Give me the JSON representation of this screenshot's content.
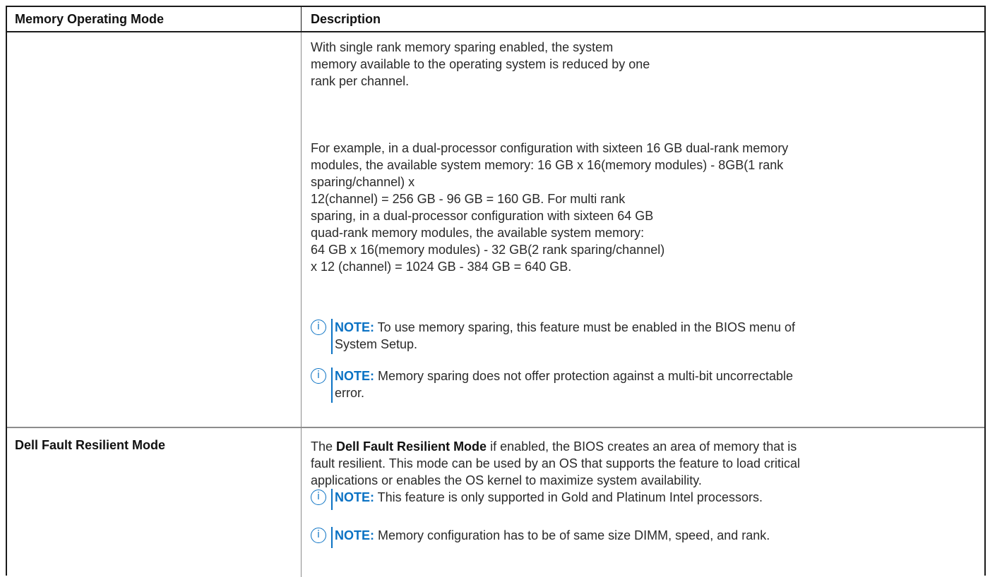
{
  "table": {
    "headers": [
      "Memory Operating Mode",
      "Description"
    ],
    "rows": [
      {
        "mode": "",
        "paragraphs": [
          [
            "With single rank memory sparing enabled, the system",
            "memory available to the operating system is reduced by one",
            "rank per channel."
          ],
          [
            "For example, in a dual-processor configuration with sixteen 16 GB dual-rank memory",
            "modules, the available system memory: 16 GB x 16(memory modules) - 8GB(1 rank",
            "sparing/channel) x",
            "12(channel) = 256 GB - 96 GB = 160 GB. For multi rank",
            "sparing, in a dual-processor configuration with sixteen 64 GB",
            "quad-rank memory modules, the available system memory:",
            "64 GB x 16(memory modules) - 32 GB(2 rank sparing/channel)",
            "x 12 (channel) = 1024 GB - 384 GB = 640 GB."
          ]
        ],
        "notes": [
          {
            "label": "NOTE:",
            "lines": [
              " To use memory sparing, this feature must be enabled in the BIOS menu of",
              "System Setup."
            ]
          },
          {
            "label": "NOTE:",
            "lines": [
              " Memory sparing does not offer protection against a multi-bit uncorrectable",
              "error."
            ]
          }
        ]
      },
      {
        "mode": "Dell Fault Resilient Mode",
        "intro_prefix": "The ",
        "intro_bold": "Dell Fault Resilient Mode",
        "intro_rest": " if enabled, the BIOS creates an area of memory that is",
        "intro_lines": [
          "fault resilient. This mode can be used by an OS that supports the feature to load critical",
          "applications or enables the OS kernel to maximize system availability."
        ],
        "notes": [
          {
            "label": "NOTE:",
            "lines": [
              " This feature is only supported in Gold and Platinum Intel processors."
            ]
          },
          {
            "label": "NOTE:",
            "lines": [
              " Memory configuration has to be of same size DIMM, speed, and rank."
            ]
          }
        ]
      }
    ]
  },
  "icons": {
    "note": "info-circle-icon"
  },
  "colors": {
    "accent": "#0a72c4",
    "border": "#1a1a1a",
    "row_divider": "#8c8c8c"
  }
}
